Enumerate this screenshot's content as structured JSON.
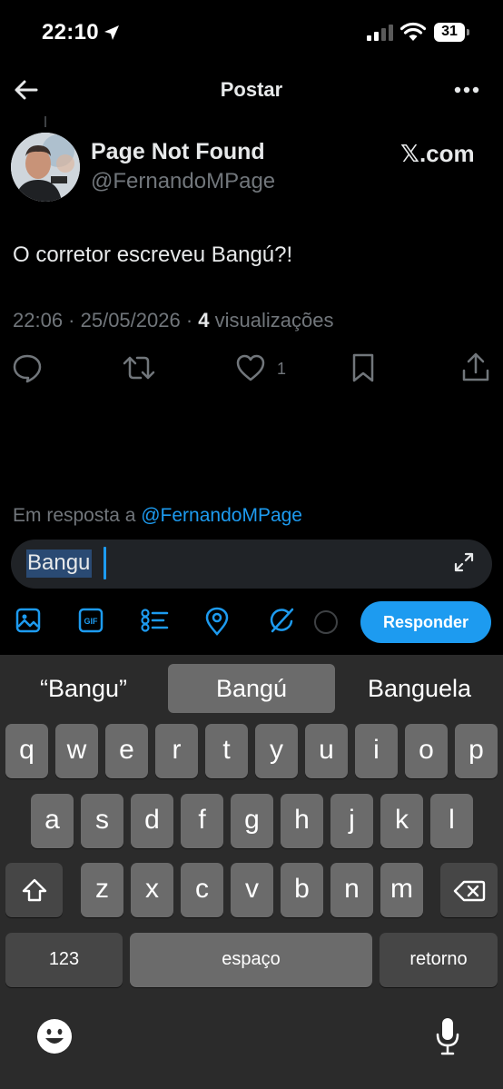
{
  "status_bar": {
    "time": "22:10",
    "battery": "31"
  },
  "nav": {
    "title": "Postar"
  },
  "tweet": {
    "author_name": "Page Not Found",
    "author_handle": "@FernandoMPage",
    "source": "𝕏.com",
    "text": "O corretor escreveu Bangú?!",
    "timestamp": "22:06 · 25/05/2026 · ",
    "views_count": "4",
    "views_label": " visualizações",
    "like_count": "1"
  },
  "reply": {
    "in_reply_to_prefix": "Em resposta a ",
    "in_reply_to_handle": "@FernandoMPage",
    "input_value": "Bangu",
    "submit_label": "Responder"
  },
  "keyboard": {
    "suggestions": [
      "“Bangu”",
      "Bangú",
      "Banguela"
    ],
    "row1": [
      "q",
      "w",
      "e",
      "r",
      "t",
      "y",
      "u",
      "i",
      "o",
      "p"
    ],
    "row2": [
      "a",
      "s",
      "d",
      "f",
      "g",
      "h",
      "j",
      "k",
      "l"
    ],
    "row3": [
      "z",
      "x",
      "c",
      "v",
      "b",
      "n",
      "m"
    ],
    "numbers_key": "123",
    "space_key": "espaço",
    "return_key": "retorno"
  },
  "colors": {
    "accent": "#1d9bf0",
    "background": "#000000",
    "muted": "#71767b"
  }
}
